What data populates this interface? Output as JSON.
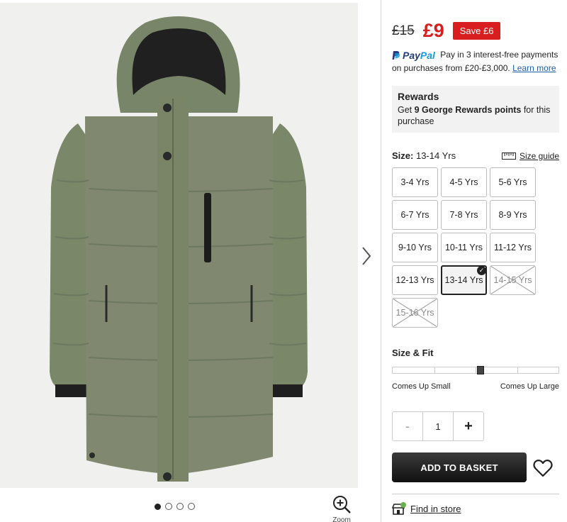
{
  "gallery": {
    "dots": [
      true,
      false,
      false,
      false
    ],
    "zoom_label": "Zoom"
  },
  "price": {
    "was": "£15",
    "now": "£9",
    "save": "Save £6"
  },
  "paypal": {
    "logo_pay": "Pay",
    "logo_pal": "Pal",
    "text": "Pay in 3 interest-free payments on purchases from £20-£3,000.",
    "link": "Learn more"
  },
  "rewards": {
    "title": "Rewards",
    "text_before": "Get ",
    "points": "9 George Rewards points",
    "text_after": " for this purchase"
  },
  "size": {
    "label": "Size:",
    "selected": "13-14 Yrs",
    "guide": "Size guide",
    "options": [
      {
        "label": "3-4 Yrs",
        "state": "available"
      },
      {
        "label": "4-5 Yrs",
        "state": "available"
      },
      {
        "label": "5-6 Yrs",
        "state": "available"
      },
      {
        "label": "6-7 Yrs",
        "state": "available"
      },
      {
        "label": "7-8 Yrs",
        "state": "available"
      },
      {
        "label": "8-9 Yrs",
        "state": "available"
      },
      {
        "label": "9-10 Yrs",
        "state": "available"
      },
      {
        "label": "10-11 Yrs",
        "state": "available"
      },
      {
        "label": "11-12 Yrs",
        "state": "available"
      },
      {
        "label": "12-13 Yrs",
        "state": "available"
      },
      {
        "label": "13-14 Yrs",
        "state": "selected"
      },
      {
        "label": "14-15 Yrs",
        "state": "out-of-stock"
      },
      {
        "label": "15-16 Yrs",
        "state": "out-of-stock"
      }
    ]
  },
  "fit": {
    "title": "Size & Fit",
    "segments": 4,
    "level": 0.53,
    "left_label": "Comes Up Small",
    "right_label": "Comes Up Large"
  },
  "quantity": {
    "minus": "-",
    "value": "1",
    "plus": "+"
  },
  "actions": {
    "add_to_basket": "ADD TO BASKET",
    "find_in_store": "Find in store"
  },
  "colors": {
    "price_red": "#d81e1e",
    "button_dark": "#222222",
    "jacket_khaki": "#7d8a6b"
  }
}
